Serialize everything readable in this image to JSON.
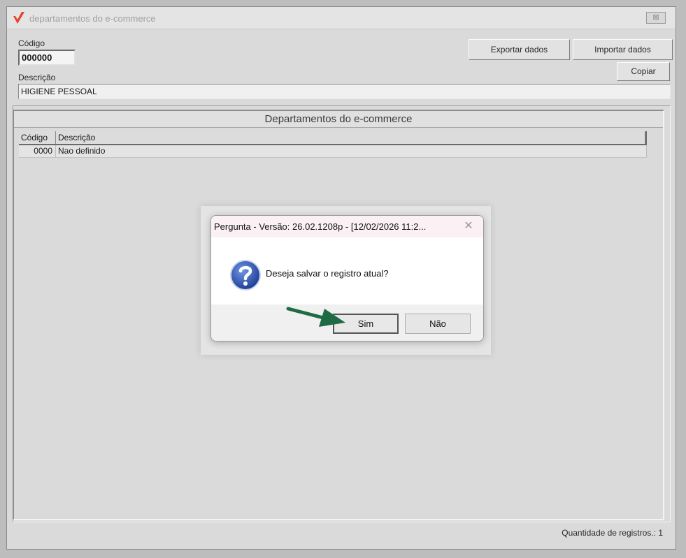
{
  "window": {
    "title": "departamentos do e-commerce",
    "close_label": "⊠"
  },
  "form": {
    "codigo_label": "Código",
    "codigo_value": "000000",
    "descricao_label": "Descrição",
    "descricao_value": "HIGIENE PESSOAL"
  },
  "buttons": {
    "exportar": "Exportar dados",
    "importar": "Importar dados",
    "copiar": "Copiar"
  },
  "panel": {
    "title": "Departamentos do e-commerce",
    "columns": [
      "Código",
      "Descrição"
    ],
    "rows": [
      {
        "codigo": "0000",
        "descricao": "Nao definido"
      }
    ]
  },
  "status": {
    "record_count": "Quantidade de registros.: 1"
  },
  "dialog": {
    "title": "Pergunta - Versão: 26.02.1208p - [12/02/2026 11:2...",
    "close_glyph": "✕",
    "message": "Deseja salvar o registro atual?",
    "yes_label": "Sim",
    "no_label": "Não",
    "icon": "question-icon"
  },
  "colors": {
    "logo": "#e8412a",
    "arrow": "#1e6b45",
    "question_icon": "#2a4fa8"
  }
}
